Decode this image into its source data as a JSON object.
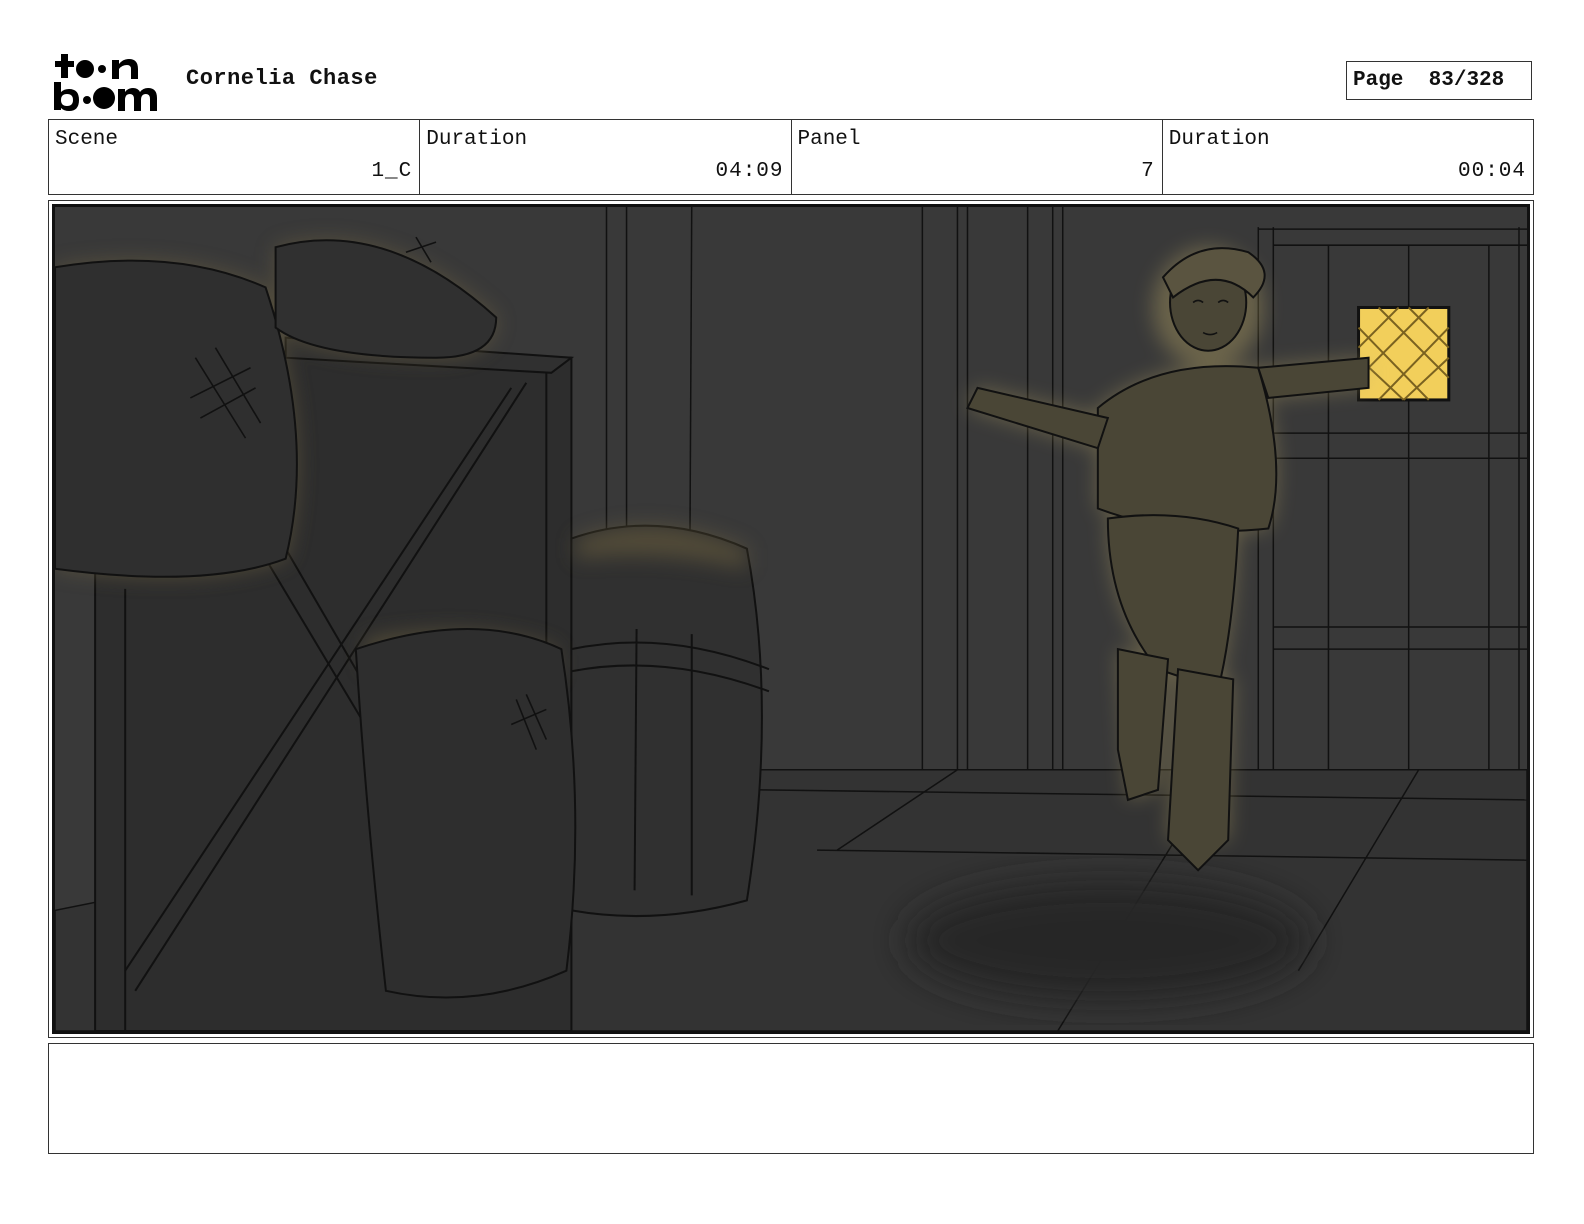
{
  "header": {
    "logo_text": "toon boom",
    "project_title": "Cornelia Chase",
    "page_label": "Page",
    "page_number": "83/328"
  },
  "info": {
    "scene_label": "Scene",
    "scene_value": "1_C",
    "scene_duration_label": "Duration",
    "scene_duration_value": "04:09",
    "panel_label": "Panel",
    "panel_value": "7",
    "panel_duration_label": "Duration",
    "panel_duration_value": "00:04"
  },
  "notes": {
    "text": ""
  },
  "colors": {
    "background": "#383838",
    "glow": "#c8b36a",
    "window_light": "#f2cf5b"
  }
}
